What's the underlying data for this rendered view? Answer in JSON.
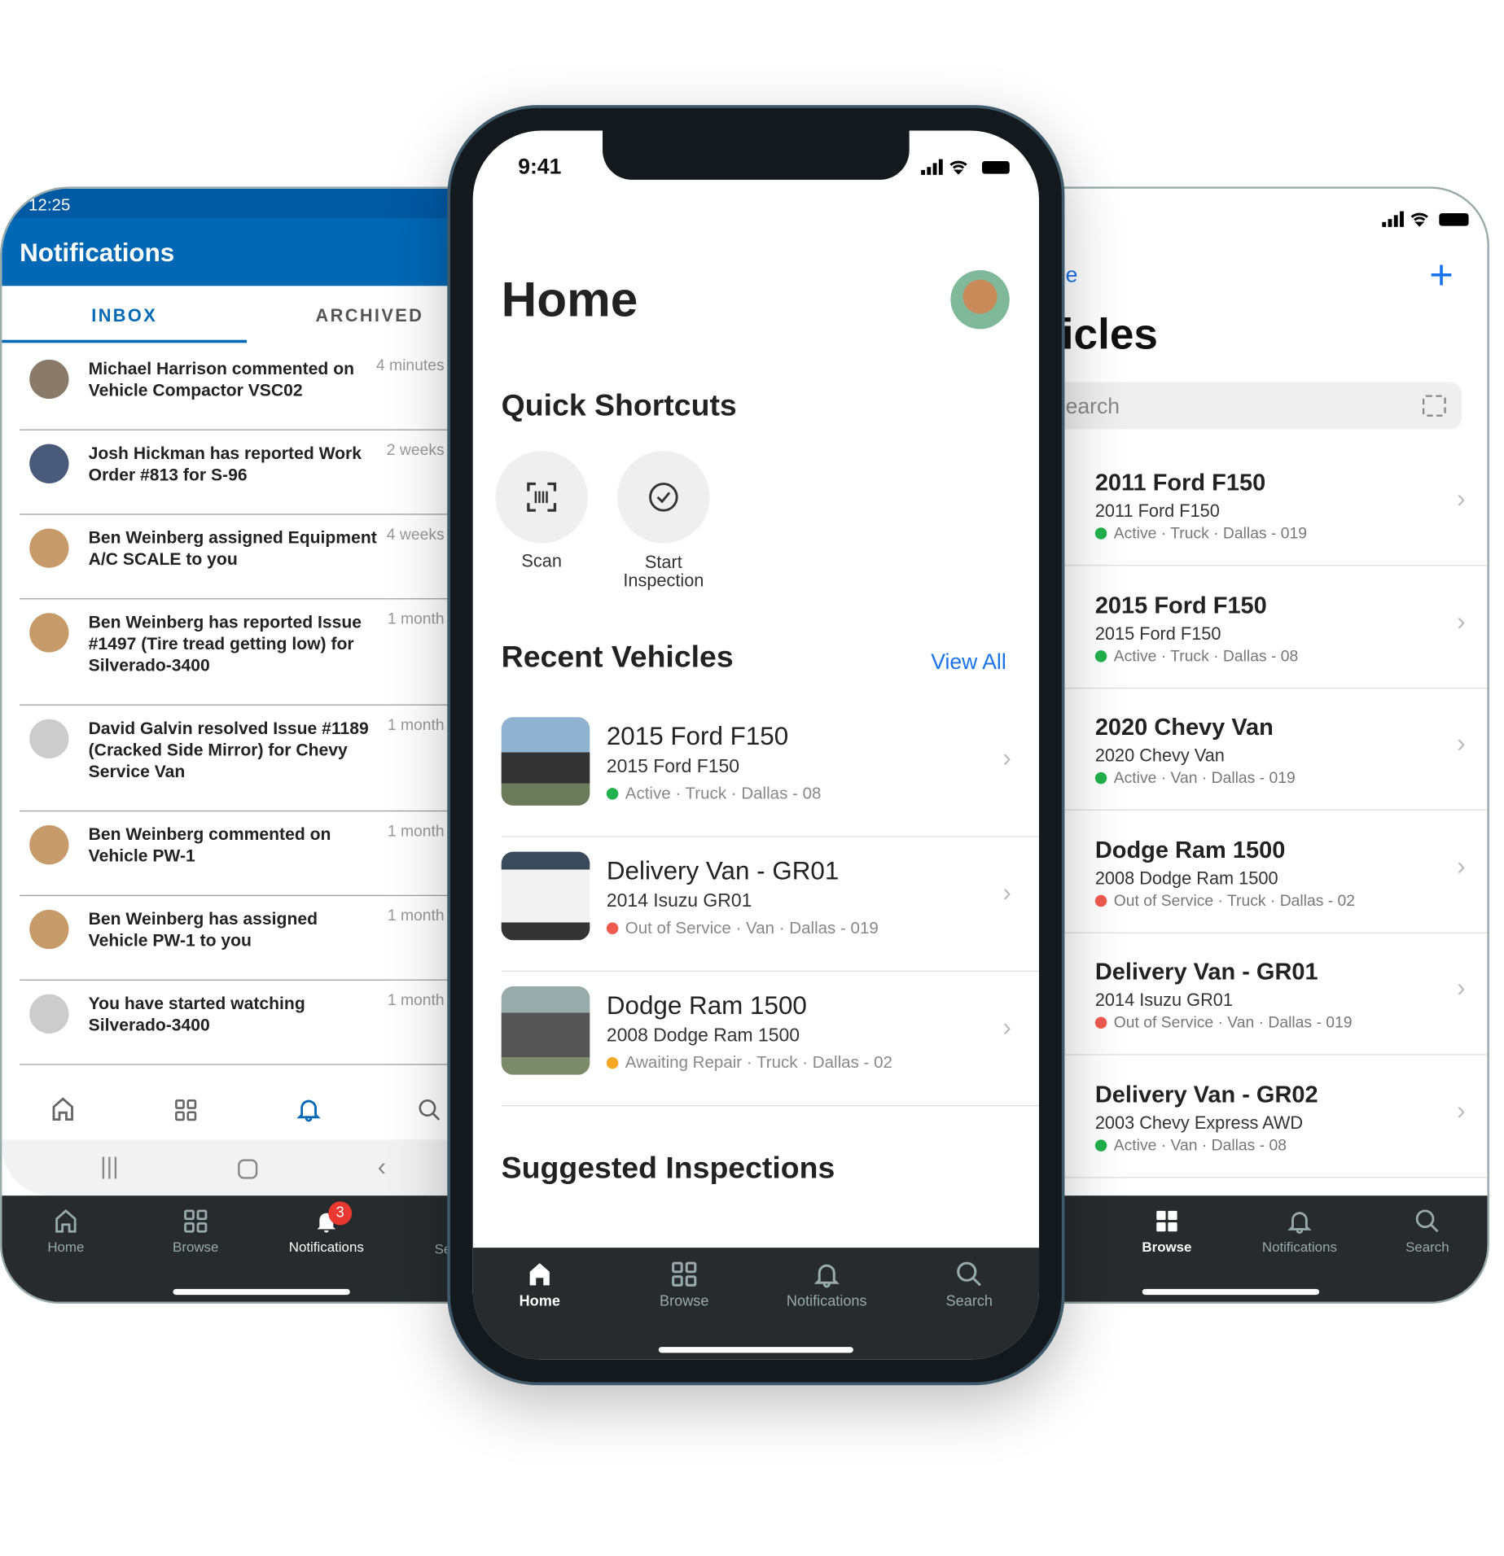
{
  "left_phone": {
    "status_time": "12:25",
    "title": "Notifications",
    "tabs": [
      "INBOX",
      "ARCHIVED"
    ],
    "notifications": [
      {
        "text": "Michael Harrison commented on Vehicle Compactor VSC02",
        "time": "4 minutes"
      },
      {
        "text": "Josh Hickman has reported Work Order #813 for S-96",
        "time": "2 weeks"
      },
      {
        "text": "Ben Weinberg assigned Equipment A/C SCALE to you",
        "time": "4 weeks"
      },
      {
        "text": "Ben Weinberg has reported Issue #1497 (Tire tread getting low) for Silverado-3400",
        "time": "1 month"
      },
      {
        "text": "David Galvin resolved Issue #1189 (Cracked Side Mirror) for Chevy Service Van",
        "time": "1 month"
      },
      {
        "text": "Ben Weinberg commented on Vehicle PW-1",
        "time": "1 month"
      },
      {
        "text": "Ben Weinberg has assigned Vehicle PW-1 to you",
        "time": "1 month"
      },
      {
        "text": "You have started watching Silverado-3400",
        "time": "1 month"
      }
    ],
    "tabbar": [
      {
        "label": "Home",
        "icon": "home-icon"
      },
      {
        "label": "Browse",
        "icon": "grid-icon"
      },
      {
        "label": "Notifications",
        "icon": "bell-icon",
        "badge": "3"
      },
      {
        "label": "Se",
        "icon": "search-icon"
      }
    ]
  },
  "center_phone": {
    "status_time": "9:41",
    "title": "Home",
    "quick_shortcuts_title": "Quick Shortcuts",
    "shortcuts": [
      {
        "label": "Scan",
        "icon": "barcode-scan-icon"
      },
      {
        "label": "Start Inspection",
        "icon": "check-circle-icon"
      }
    ],
    "recent_title": "Recent Vehicles",
    "view_all": "View All",
    "vehicles": [
      {
        "name": "2015 Ford F150",
        "model": "2015 Ford F150",
        "status": "Active",
        "status_color": "#22b14c",
        "meta": " · Truck · Dallas - 08"
      },
      {
        "name": "Delivery Van - GR01",
        "model": "2014 Isuzu GR01",
        "status": "Out of Service",
        "status_color": "#f05a4f",
        "meta": " · Van · Dallas - 019"
      },
      {
        "name": "Dodge Ram 1500",
        "model": "2008 Dodge Ram 1500",
        "status": "Awaiting Repair",
        "status_color": "#f5a623",
        "meta": " · Truck · Dallas - 02"
      }
    ],
    "suggested_title": "Suggested Inspections",
    "tabbar": [
      {
        "label": "Home",
        "icon": "home-icon"
      },
      {
        "label": "Browse",
        "icon": "grid-icon"
      },
      {
        "label": "Notifications",
        "icon": "bell-icon"
      },
      {
        "label": "Search",
        "icon": "search-icon"
      }
    ]
  },
  "right_phone": {
    "back_label": "e",
    "title": "icles",
    "search_placeholder": "earch",
    "vehicles": [
      {
        "name": "2011 Ford F150",
        "model": "2011 Ford F150",
        "status": "Active",
        "status_color": "#22b14c",
        "meta": " · Truck · Dallas - 019"
      },
      {
        "name": "2015 Ford F150",
        "model": "2015 Ford F150",
        "status": "Active",
        "status_color": "#22b14c",
        "meta": " · Truck · Dallas - 08"
      },
      {
        "name": "2020 Chevy Van",
        "model": "2020 Chevy Van",
        "status": "Active",
        "status_color": "#22b14c",
        "meta": " · Van · Dallas - 019"
      },
      {
        "name": "Dodge Ram 1500",
        "model": "2008 Dodge Ram 1500",
        "status": "Out of Service",
        "status_color": "#f05a4f",
        "meta": " · Truck · Dallas - 02"
      },
      {
        "name": "Delivery Van - GR01",
        "model": "2014 Isuzu GR01",
        "status": "Out of Service",
        "status_color": "#f05a4f",
        "meta": " · Van · Dallas - 019"
      },
      {
        "name": "Delivery Van - GR02",
        "model": "2003 Chevy Express AWD",
        "status": "Active",
        "status_color": "#22b14c",
        "meta": " · Van · Dallas - 08"
      }
    ],
    "tabbar": [
      {
        "label": "Browse",
        "icon": "grid-icon"
      },
      {
        "label": "Notifications",
        "icon": "bell-icon"
      },
      {
        "label": "Search",
        "icon": "search-icon"
      }
    ]
  },
  "colors": {
    "android_blue": "#0068b5",
    "ios_blue": "#1a73e8",
    "dark_bar": "#272b2e"
  }
}
